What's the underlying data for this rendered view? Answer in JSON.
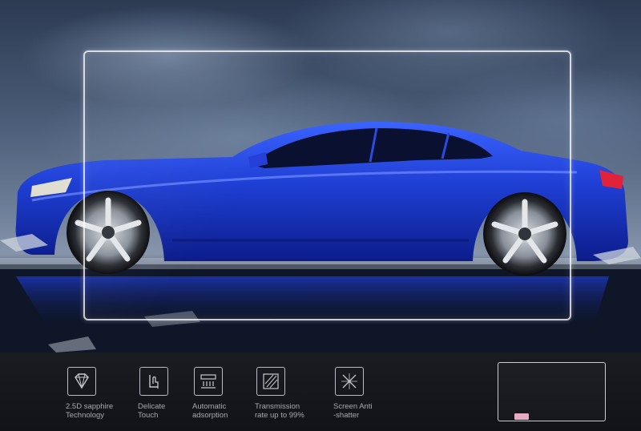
{
  "hero": {
    "background": "stormy-sky",
    "subject": "blue-sports-car",
    "car_color": "#1f3fd4"
  },
  "features": [
    {
      "icon": "diamond-icon",
      "label": "2.5D sapphire\nTechnology"
    },
    {
      "icon": "finger-touch-icon",
      "label": "Delicate\nTouch"
    },
    {
      "icon": "absorption-icon",
      "label": "Automatic\nadsorption"
    },
    {
      "icon": "transmission-icon",
      "label": "Transmission\nrate up to 99%"
    },
    {
      "icon": "anti-shatter-icon",
      "label": "Screen Anti\n-shatter"
    }
  ],
  "colors": {
    "strip_bg": "#15171c",
    "icon_stroke": "#b9bcc4",
    "label_text": "#a6a9b1",
    "frame": "#ffffff",
    "tab": "#e8a9c3"
  }
}
